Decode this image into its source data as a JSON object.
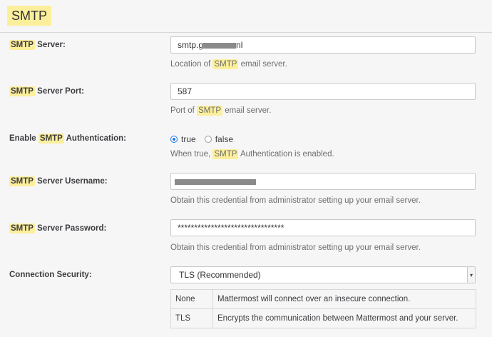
{
  "header": {
    "title": "SMTP"
  },
  "fields": {
    "server": {
      "label_hl": "SMTP",
      "label_rest": " Server:",
      "value_prefix": "smtp.g",
      "value_suffix": "nl",
      "help_pre": "Location of ",
      "help_hl": "SMTP",
      "help_post": " email server."
    },
    "port": {
      "label_hl": "SMTP",
      "label_rest": " Server Port:",
      "value": "587",
      "help_pre": "Port of ",
      "help_hl": "SMTP",
      "help_post": " email server."
    },
    "auth": {
      "label_pre": "Enable ",
      "label_hl": "SMTP",
      "label_rest": " Authentication:",
      "true_label": "true",
      "false_label": "false",
      "selected": "true",
      "help_pre": "When true, ",
      "help_hl": "SMTP",
      "help_post": " Authentication is enabled."
    },
    "username": {
      "label_hl": "SMTP",
      "label_rest": " Server Username:",
      "help": "Obtain this credential from administrator setting up your email server."
    },
    "password": {
      "label_hl": "SMTP",
      "label_rest": " Server Password:",
      "value": "********************************",
      "help": "Obtain this credential from administrator setting up your email server."
    },
    "security": {
      "label": "Connection Security:",
      "selected": "TLS (Recommended)",
      "options": [
        {
          "key": "None",
          "desc": "Mattermost will connect over an insecure connection."
        },
        {
          "key": "TLS",
          "desc": "Encrypts the communication between Mattermost and your server."
        }
      ]
    }
  }
}
